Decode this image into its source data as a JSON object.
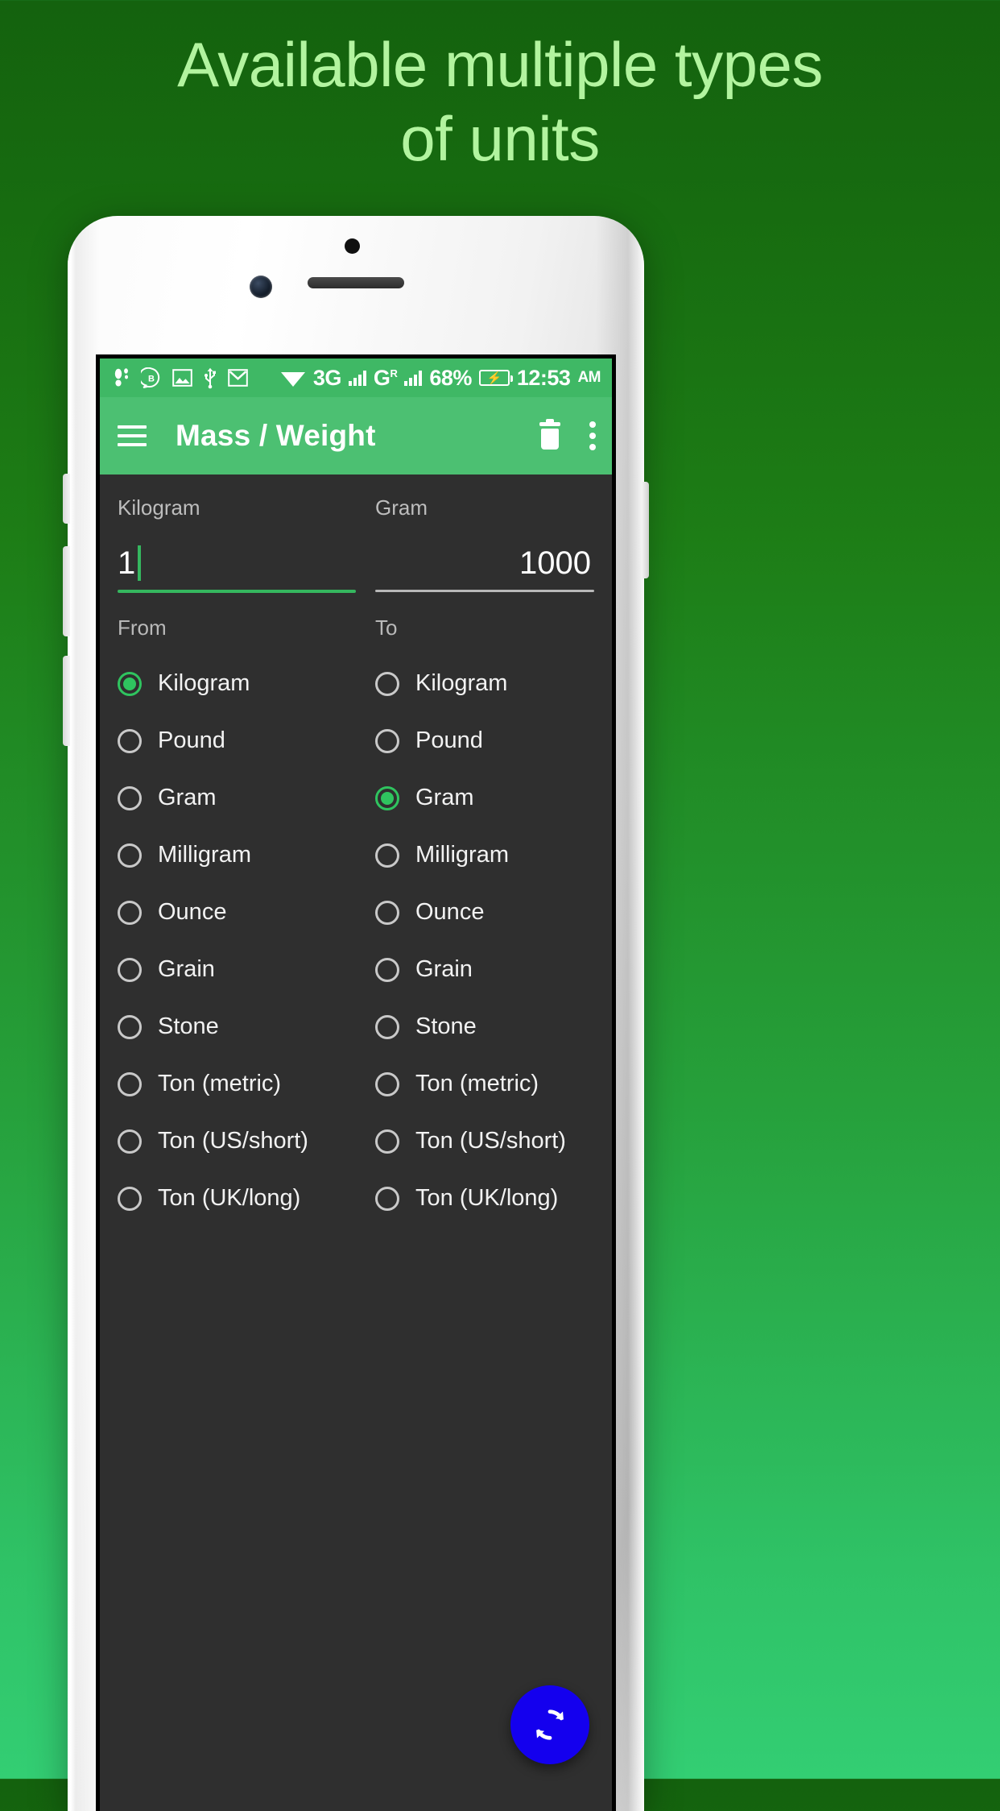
{
  "promo": {
    "line1": "Available multiple types",
    "line2": "of units",
    "text_color": "#b2f49f",
    "bg_top_color": "#14620e",
    "bg_bottom_color": "#33ce73"
  },
  "statusbar": {
    "background": "#3fb865",
    "left_icons": [
      "pedometer-icon",
      "bbm-icon",
      "screenshot-image-icon",
      "usb-icon",
      "gmail-icon"
    ],
    "wifi_icon": "wifi-icon",
    "network1_label": "3G",
    "network1_icon": "signal-bars-icon",
    "network2_label": "G",
    "network2_superscript": "R",
    "network2_icon": "signal-bars-icon",
    "battery_percent": "68%",
    "battery_icon": "battery-charging-icon",
    "time": "12:53",
    "time_meridiem": "AM"
  },
  "appbar": {
    "background": "#4cc072",
    "menu_icon": "hamburger-menu-icon",
    "title": "Mass / Weight",
    "delete_icon": "trash-icon",
    "overflow_icon": "kebab-menu-icon"
  },
  "converter": {
    "from_field": {
      "unit_label": "Kilogram",
      "value": "1",
      "focused": true,
      "accent_color": "#35b75f"
    },
    "to_field": {
      "unit_label": "Gram",
      "value": "1000",
      "focused": false,
      "underline_color": "#b8b8b8"
    },
    "from_header": "From",
    "to_header": "To",
    "from_selected": "Kilogram",
    "to_selected": "Gram",
    "units": [
      "Kilogram",
      "Pound",
      "Gram",
      "Milligram",
      "Ounce",
      "Grain",
      "Stone",
      "Ton (metric)",
      "Ton (US/short)",
      "Ton (UK/long)"
    ],
    "selected_radio_color": "#2fc45f",
    "unselected_radio_color": "#c9c9c9"
  },
  "fab": {
    "icon": "swap-refresh-icon",
    "background": "#1400ee"
  }
}
